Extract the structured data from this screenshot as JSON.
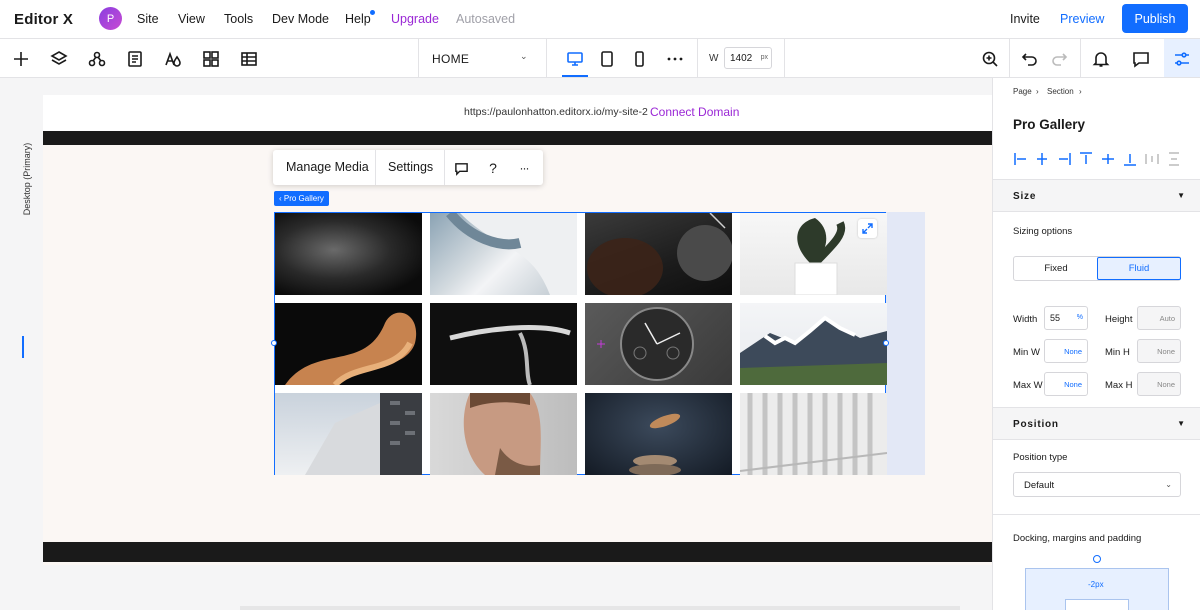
{
  "app": {
    "logo": "Editor X",
    "avatar_initial": "P"
  },
  "topbar": {
    "menu": [
      "Site",
      "View",
      "Tools",
      "Dev Mode",
      "Help"
    ],
    "upgrade": "Upgrade",
    "status": "Autosaved",
    "invite": "Invite",
    "preview": "Preview",
    "publish": "Publish"
  },
  "toolbar": {
    "page_name": "HOME",
    "width_label": "W",
    "width_value": "1402",
    "width_unit": "px",
    "active_device": "desktop"
  },
  "canvas": {
    "breakpoint_label": "Desktop (Primary)",
    "url": "https://paulonhatton.editorx.io/my-site-2",
    "connect_domain": "Connect Domain"
  },
  "floating_toolbar": {
    "manage_media": "Manage Media",
    "settings": "Settings",
    "help_glyph": "?",
    "more_glyph": "···"
  },
  "gallery": {
    "tag": "‹ Pro Gallery",
    "tiles": [
      {
        "name": "dark-terrain"
      },
      {
        "name": "abstract-curve"
      },
      {
        "name": "coffee-cup"
      },
      {
        "name": "potted-plant"
      },
      {
        "name": "copper-ribbon"
      },
      {
        "name": "bicycle-handlebar"
      },
      {
        "name": "wrist-watch"
      },
      {
        "name": "snowy-mountain"
      },
      {
        "name": "building"
      },
      {
        "name": "man-portrait"
      },
      {
        "name": "floating-stones"
      },
      {
        "name": "white-arches"
      }
    ]
  },
  "panel": {
    "breadcrumb": [
      "Page",
      "Section"
    ],
    "title": "Pro Gallery",
    "size": {
      "heading": "Size",
      "sizing_options_label": "Sizing options",
      "options": [
        "Fixed",
        "Fluid"
      ],
      "selected": "Fluid",
      "width_label": "Width",
      "width_value": "55",
      "width_unit": "%",
      "height_label": "Height",
      "height_value": "Auto",
      "min_w_label": "Min W",
      "min_w_value": "None",
      "min_h_label": "Min H",
      "min_h_value": "None",
      "max_w_label": "Max W",
      "max_w_value": "None",
      "max_h_label": "Max H",
      "max_h_value": "None"
    },
    "position": {
      "heading": "Position",
      "type_label": "Position type",
      "type_value": "Default"
    },
    "docking": {
      "label": "Docking, margins and padding",
      "top_margin": "-2px"
    }
  },
  "colors": {
    "accent": "#116dff",
    "upgrade": "#9a27d5",
    "dark_band": "#1a1a1a"
  }
}
